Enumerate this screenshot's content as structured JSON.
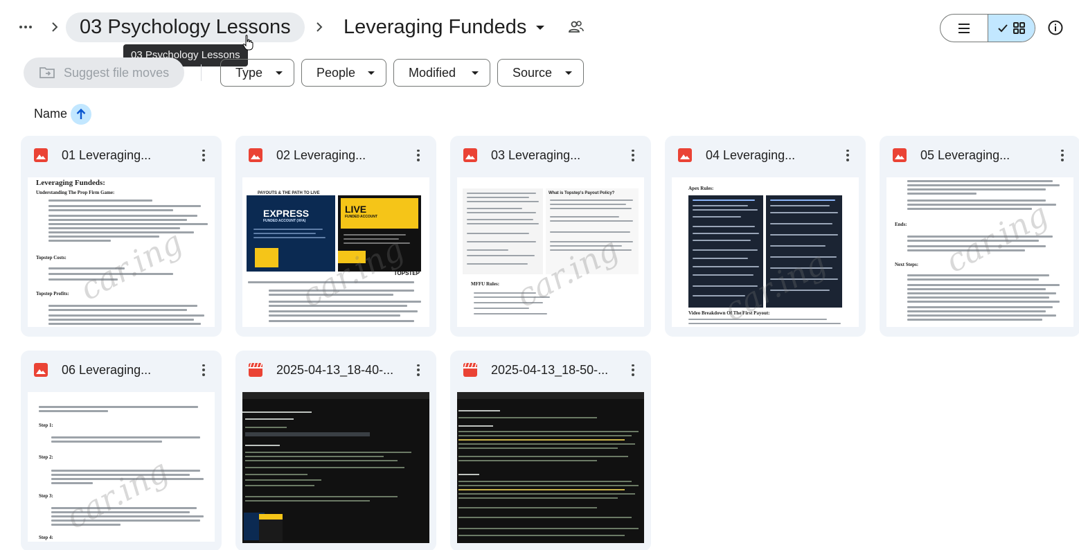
{
  "breadcrumb": {
    "parent": "03 Psychology Lessons",
    "current": "Leveraging Fundeds",
    "tooltip": "03 Psychology Lessons"
  },
  "toolbar": {
    "suggest_label": "Suggest file moves",
    "filters": [
      "Type",
      "People",
      "Modified",
      "Source"
    ]
  },
  "sort": {
    "label": "Name",
    "direction": "ascending"
  },
  "files": [
    {
      "name": "01 Leveraging...",
      "kind": "image",
      "thumb": {
        "heading": "Leveraging Fundeds:",
        "subs": [
          "Understanding The Prop Firm Game:",
          "Topstep Costs:",
          "Topstep Profits:"
        ]
      }
    },
    {
      "name": "02 Leveraging...",
      "kind": "image",
      "thumb": {
        "left_title": "PAYOUTS & THE PATH TO LIVE FUNDING",
        "left_badge": "EXPRESS",
        "left_badge_sub": "FUNDED ACCOUNT (XFA)",
        "right_badge": "LIVE",
        "right_badge_sub": "FUNDED ACCOUNT",
        "brand": "TOPSTEP"
      }
    },
    {
      "name": "03 Leveraging...",
      "kind": "image",
      "thumb": {
        "right_title": "What is Topstep's Payout Policy?",
        "footer": "MFFU Rules:"
      }
    },
    {
      "name": "04 Leveraging...",
      "kind": "image",
      "thumb": {
        "heading": "Apex Rules:",
        "footer": "Video Breakdown Of The First Payout:"
      }
    },
    {
      "name": "05 Leveraging...",
      "kind": "image",
      "thumb": {
        "subs": [
          "Ends:",
          "Next Steps:"
        ]
      }
    },
    {
      "name": "06 Leveraging...",
      "kind": "image",
      "thumb": {
        "subs": [
          "Step 1:",
          "Step 2:",
          "Step 3:",
          "Step 4:"
        ]
      }
    },
    {
      "name": "2025-04-13_18-40-...",
      "kind": "video"
    },
    {
      "name": "2025-04-13_18-50-...",
      "kind": "video"
    }
  ],
  "watermark": "car.ing",
  "colors": {
    "accent_blue": "#c2e7ff",
    "image_icon_red": "#ea4335",
    "card_bg": "#f0f4f9",
    "chip_bg": "#e9ecef"
  },
  "icons": {
    "more": "more-horizontal-icon",
    "shared": "people-icon",
    "list_view": "list-view-icon",
    "grid_view": "grid-view-icon",
    "info": "info-icon",
    "suggest": "folder-move-icon",
    "sort": "arrow-up-icon",
    "image_file": "image-file-icon",
    "video_file": "video-file-icon"
  }
}
